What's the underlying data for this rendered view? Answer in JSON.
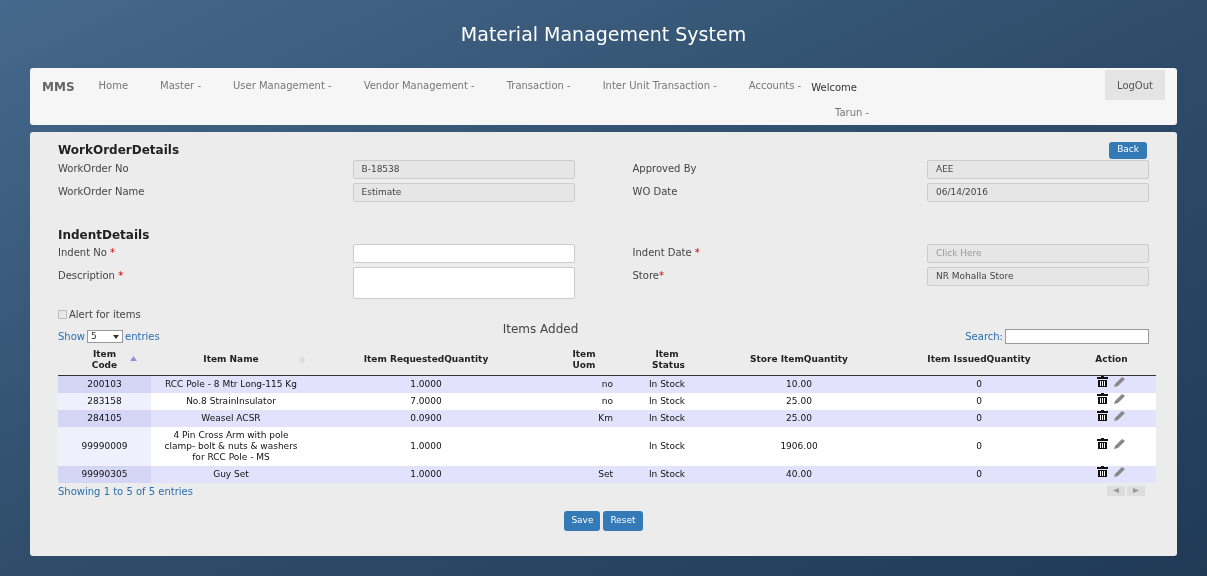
{
  "app_title": "Material Management System",
  "navbar": {
    "brand": "MMS",
    "items": [
      {
        "label": "Home"
      },
      {
        "label": "Master -"
      },
      {
        "label": "User Management -"
      },
      {
        "label": "Vendor Management -"
      },
      {
        "label": "Transaction -"
      },
      {
        "label": "Inter Unit Transaction -"
      },
      {
        "label": "Accounts -"
      }
    ],
    "welcome": "Welcome",
    "user": "Tarun -",
    "logout": "LogOut"
  },
  "work_order": {
    "heading": "WorkOrderDetails",
    "back": "Back",
    "fields": [
      {
        "label": "WorkOrder No",
        "value": "B-18538",
        "readonly": true
      },
      {
        "label": "Approved By",
        "value": "AEE",
        "readonly": true
      },
      {
        "label": "WorkOrder Name",
        "value": "Estimate",
        "readonly": true
      },
      {
        "label": "WO Date",
        "value": "06/14/2016",
        "readonly": true
      }
    ]
  },
  "indent": {
    "heading": "IndentDetails",
    "fields": [
      {
        "label": "Indent No",
        "required_mark": " *",
        "kind": "input",
        "readonly": false
      },
      {
        "label": "Indent Date",
        "required_mark": " *",
        "kind": "input",
        "placeholder": "Click Here",
        "readonly": true
      },
      {
        "label": "Description",
        "required_mark": " *",
        "kind": "textarea",
        "readonly": false
      },
      {
        "label": "Store",
        "required_mark": "*",
        "kind": "input",
        "value": "NR Mohalla Store",
        "readonly": true
      }
    ],
    "alert": {
      "label": "Alert for items",
      "checked": false
    }
  },
  "items": {
    "title": "Items Added",
    "show_label": "Show",
    "page_size": "5",
    "entries_label": "entries",
    "search_label": "Search:",
    "columns": [
      {
        "label": "Item Code",
        "sorted": true
      },
      {
        "label": "Item Name",
        "sorted": false
      },
      {
        "label": "Item RequestedQuantity"
      },
      {
        "label": "Item Uom"
      },
      {
        "label": "Item Status"
      },
      {
        "label": "Store ItemQuantity"
      },
      {
        "label": "Item IssuedQuantity"
      },
      {
        "label": "Action"
      }
    ],
    "rows": [
      {
        "cells": [
          "200103",
          "RCC Pole - 8 Mtr Long-115 Kg",
          "1.0000",
          "no",
          "In Stock",
          "10.00",
          "0"
        ]
      },
      {
        "cells": [
          "283158",
          "No.8 StrainInsulator",
          "7.0000",
          "no",
          "In Stock",
          "25.00",
          "0"
        ]
      },
      {
        "cells": [
          "284105",
          "Weasel ACSR",
          "0.0900",
          "Km",
          "In Stock",
          "25.00",
          "0"
        ]
      },
      {
        "cells": [
          "99990009",
          "4 Pin Cross Arm with pole clamp- bolt & nuts & washers for RCC Pole - MS",
          "1.0000",
          "",
          "In Stock",
          "1906.00",
          "0"
        ]
      },
      {
        "cells": [
          "99990305",
          "Guy Set",
          "1.0000",
          "Set",
          "In Stock",
          "40.00",
          "0"
        ]
      }
    ],
    "info": "Showing 1 to 5 of 5 entries"
  },
  "buttons": [
    "Save",
    "Reset"
  ]
}
